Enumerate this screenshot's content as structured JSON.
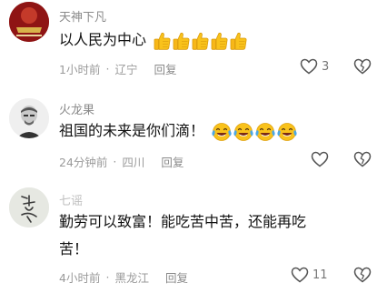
{
  "comments": [
    {
      "username": "天神下凡",
      "content": "以人民为中心",
      "emoji_name": "thumbs-up-icon",
      "emoji_count": 5,
      "time": "1小时前",
      "location": "辽宁",
      "reply_label": "回复",
      "likes": "3"
    },
    {
      "username": "火龙果",
      "content": "祖国的未来是你们滴！",
      "emoji_name": "laugh-cry-icon",
      "emoji_count": 4,
      "time": "24分钟前",
      "location": "四川",
      "reply_label": "回复",
      "likes": ""
    },
    {
      "username": "七谣",
      "content_line1": "勤劳可以致富！能吃苦中苦，还能再吃",
      "content_line2": "苦！",
      "time": "4小时前",
      "location": "黑龙江",
      "reply_label": "回复",
      "likes": "11"
    }
  ],
  "colors": {
    "text": "#111111",
    "muted": "#9a9a9a",
    "emoji_yellow": "#f9c21b"
  }
}
